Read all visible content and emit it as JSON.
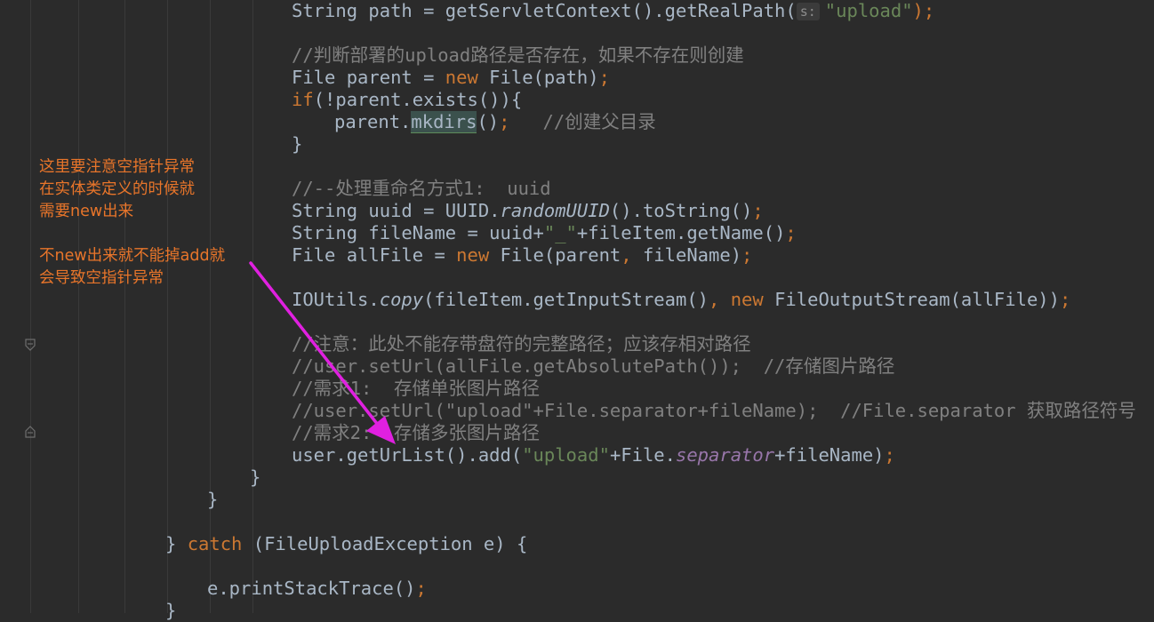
{
  "editor": {
    "lines": [
      {
        "id": "l01",
        "parts": [
          {
            "t": "String path = getServletContext().getRealPath("
          },
          {
            "t": "s:",
            "c": "hint"
          },
          {
            "t": "\"upload\"",
            "c": "str"
          },
          {
            "t": ");",
            "c": "kw"
          }
        ]
      },
      {
        "id": "l02",
        "parts": [
          {
            "t": "//判断部署的upload路径是否存在，如果不存在则创建",
            "c": "cm"
          }
        ]
      },
      {
        "id": "l03",
        "parts": [
          {
            "t": "File parent = "
          },
          {
            "t": "new",
            "c": "kw"
          },
          {
            "t": " File(path)"
          },
          {
            "t": ";",
            "c": "kw"
          }
        ]
      },
      {
        "id": "l04",
        "parts": [
          {
            "t": "if",
            "c": "kw"
          },
          {
            "t": "(!parent.exists()){"
          }
        ]
      },
      {
        "id": "l05",
        "parts": [
          {
            "t": "parent."
          },
          {
            "t": "mkdirs",
            "c": "hl"
          },
          {
            "t": "()"
          },
          {
            "t": ";",
            "c": "kw"
          },
          {
            "t": "   //创建父目录",
            "c": "cm"
          }
        ]
      },
      {
        "id": "l06",
        "parts": [
          {
            "t": "}"
          }
        ]
      },
      {
        "id": "l07",
        "parts": [
          {
            "t": "//--处理重命名方式1:  uuid",
            "c": "cm"
          }
        ]
      },
      {
        "id": "l08",
        "parts": [
          {
            "t": "String uuid = UUID."
          },
          {
            "t": "randomUUID",
            "c": "it"
          },
          {
            "t": "().toString()"
          },
          {
            "t": ";",
            "c": "kw"
          }
        ]
      },
      {
        "id": "l09",
        "parts": [
          {
            "t": "String fileName = uuid+"
          },
          {
            "t": "\"_\"",
            "c": "str"
          },
          {
            "t": "+fileItem.getName()"
          },
          {
            "t": ";",
            "c": "kw"
          }
        ]
      },
      {
        "id": "l10",
        "parts": [
          {
            "t": "File allFile = "
          },
          {
            "t": "new",
            "c": "kw"
          },
          {
            "t": " File(parent"
          },
          {
            "t": ",",
            "c": "kw"
          },
          {
            "t": " fileName)"
          },
          {
            "t": ";",
            "c": "kw"
          }
        ]
      },
      {
        "id": "l11",
        "parts": [
          {
            "t": "IOUtils."
          },
          {
            "t": "copy",
            "c": "it"
          },
          {
            "t": "(fileItem.getInputStream()"
          },
          {
            "t": ",",
            "c": "kw"
          },
          {
            "t": " "
          },
          {
            "t": "new",
            "c": "kw"
          },
          {
            "t": " FileOutputStream(allFile))"
          },
          {
            "t": ";",
            "c": "kw"
          }
        ]
      },
      {
        "id": "l12",
        "parts": [
          {
            "t": "//注意：此处不能存带盘符的完整路径；应该存相对路径",
            "c": "cm"
          }
        ]
      },
      {
        "id": "l13",
        "parts": [
          {
            "t": "//user.setUrl(allFile.getAbsolutePath());  //存储图片路径",
            "c": "cm"
          }
        ]
      },
      {
        "id": "l14",
        "parts": [
          {
            "t": "//需求1:  存储单张图片路径",
            "c": "cm"
          }
        ]
      },
      {
        "id": "l15",
        "parts": [
          {
            "t": "//user.setUrl(\"upload\"+File.separator+fileName);  //File.separator 获取路径符号",
            "c": "cm"
          }
        ]
      },
      {
        "id": "l16",
        "parts": [
          {
            "t": "//需求2:  存储多张图片路径",
            "c": "cm"
          }
        ]
      },
      {
        "id": "l17",
        "parts": [
          {
            "t": "user.getUrList().add("
          },
          {
            "t": "\"upload\"",
            "c": "str"
          },
          {
            "t": "+File."
          },
          {
            "t": "separator",
            "c": "fld"
          },
          {
            "t": "+fileName)"
          },
          {
            "t": ";",
            "c": "kw"
          }
        ]
      },
      {
        "id": "l18",
        "parts": [
          {
            "t": "}"
          }
        ]
      },
      {
        "id": "l19",
        "parts": [
          {
            "t": "}"
          }
        ]
      },
      {
        "id": "l20",
        "parts": [
          {
            "t": "} "
          },
          {
            "t": "catch",
            "c": "kw"
          },
          {
            "t": " (FileUploadException e) {"
          }
        ]
      },
      {
        "id": "l21",
        "parts": [
          {
            "t": "e.printStackTrace()"
          },
          {
            "t": ";",
            "c": "kw"
          }
        ]
      },
      {
        "id": "l22",
        "parts": [
          {
            "t": "}"
          }
        ]
      }
    ]
  },
  "annotation": {
    "lines": [
      "这里要注意空指针异常",
      "在实体类定义的时候就",
      "需要new出来",
      "",
      "不new出来就不能掉add就",
      "会导致空指针异常"
    ],
    "color": "#e8752a"
  },
  "arrow": {
    "color": "#e020e0"
  },
  "colors": {
    "background": "#2b2b2b",
    "text": "#a9b7c6",
    "keyword": "#cc7832",
    "string": "#6a8759",
    "comment": "#808080",
    "field": "#9876aa"
  }
}
